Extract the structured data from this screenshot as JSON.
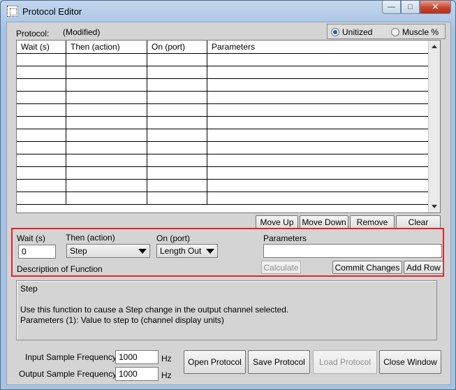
{
  "window": {
    "title": "Protocol Editor",
    "controls": {
      "minimize": "—",
      "maximize": "□",
      "close": "✕"
    }
  },
  "protocol": {
    "label": "Protocol:",
    "status": "(Modified)"
  },
  "mode": {
    "unitized": "Unitized",
    "muscle": "Muscle %",
    "selected": "Unitized"
  },
  "table": {
    "columns": [
      "Wait (s)",
      "Then (action)",
      "On (port)",
      "Parameters"
    ],
    "empty_rows": 12
  },
  "table_actions": {
    "move_up": "Move Up",
    "move_down": "Move Down",
    "remove": "Remove",
    "clear": "Clear"
  },
  "editor": {
    "wait_label": "Wait (s)",
    "wait_value": "0",
    "action_label": "Then (action)",
    "action_value": "Step",
    "port_label": "On (port)",
    "port_value": "Length Out",
    "params_label": "Parameters",
    "params_value": "",
    "calculate": "Calculate",
    "commit": "Commit Changes",
    "add_row": "Add Row",
    "description_label": "Description of Function"
  },
  "description": {
    "title": "Step",
    "line1": "Use this function to cause a Step change in the output channel selected.",
    "line2": "Parameters (1): Value to step to (channel display units)"
  },
  "sampling": {
    "input_label": "Input Sample Frequency",
    "input_value": "1000",
    "input_unit": "Hz",
    "output_label": "Output Sample Frequency",
    "output_value": "1000",
    "output_unit": "Hz"
  },
  "footer": {
    "open": "Open Protocol",
    "save": "Save Protocol",
    "load": "Load Protocol",
    "close": "Close Window"
  }
}
